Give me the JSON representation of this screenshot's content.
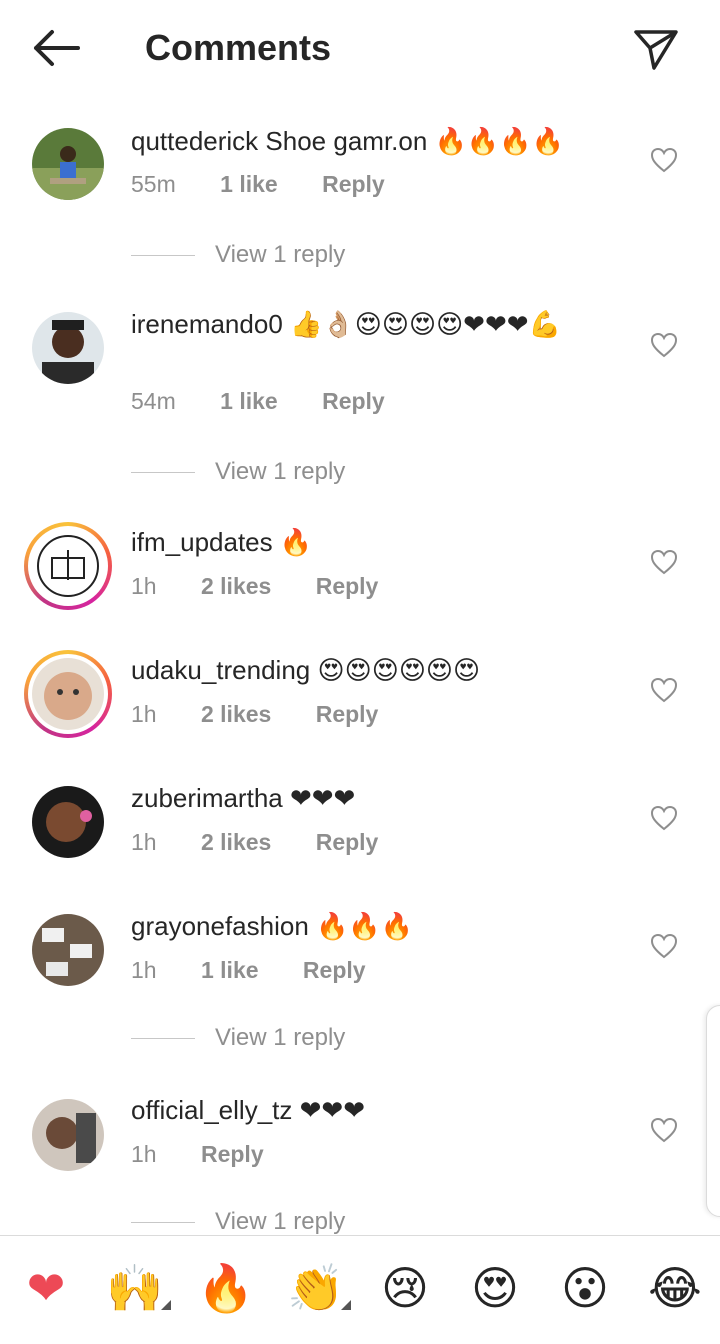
{
  "header": {
    "title": "Comments",
    "back_icon": "arrow-left-icon",
    "send_icon": "paper-plane-icon"
  },
  "comments": [
    {
      "username": "quttederick",
      "text": "Shoe gamr.on 🔥🔥🔥🔥",
      "time": "55m",
      "likes": "1 like",
      "reply": "Reply",
      "view_replies": "View 1 reply"
    },
    {
      "username": "irenemando0",
      "text": "👍👌🏼😍😍😍😍❤❤❤💪",
      "time": "54m",
      "likes": "1 like",
      "reply": "Reply",
      "view_replies": "View 1 reply"
    },
    {
      "username": "ifm_updates",
      "text": "🔥",
      "time": "1h",
      "likes": "2 likes",
      "reply": "Reply"
    },
    {
      "username": "udaku_trending",
      "text": "😍😍😍😍😍😍",
      "time": "1h",
      "likes": "2 likes",
      "reply": "Reply"
    },
    {
      "username": "zuberimartha",
      "text": "❤❤❤",
      "time": "1h",
      "likes": "2 likes",
      "reply": "Reply"
    },
    {
      "username": "grayonefashion",
      "text": "🔥🔥🔥",
      "time": "1h",
      "likes": "1 like",
      "reply": "Reply",
      "view_replies": "View 1 reply"
    },
    {
      "username": "official_elly_tz",
      "text": "❤❤❤",
      "time": "1h",
      "reply": "Reply",
      "view_replies": "View 1 reply"
    }
  ],
  "reactions": [
    "❤",
    "🙌",
    "🔥",
    "👏",
    "😢",
    "😍",
    "😮",
    "😂"
  ],
  "colors": {
    "ring_start": "#f9c33b",
    "ring_mid": "#d6249f",
    "muted": "#8e8e8e",
    "heart_red": "#ed4956"
  }
}
